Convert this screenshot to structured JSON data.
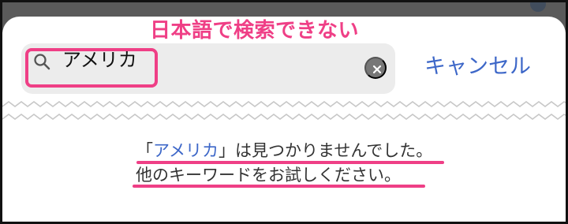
{
  "annotation": {
    "heading": "日本語で検索できない"
  },
  "search": {
    "value": "アメリカ",
    "placeholder": ""
  },
  "actions": {
    "cancel_label": "キャンセル"
  },
  "result_message": {
    "line1_open_quote": "「",
    "line1_keyword": "アメリカ",
    "line1_close_quote": "」",
    "line1_rest": "は見つかりませんでした。",
    "line2": "他のキーワードをお試しください。"
  },
  "colors": {
    "annotation_pink": "#ef3f86",
    "accent_blue": "#3d67c8",
    "field_background": "#ececec",
    "clear_button_gray": "#777777",
    "text_gray": "#333333",
    "top_strip_gray": "#5a5a5a"
  },
  "icons": {
    "search": "search-icon",
    "clear": "clear-icon",
    "divider": "zigzag-divider"
  }
}
